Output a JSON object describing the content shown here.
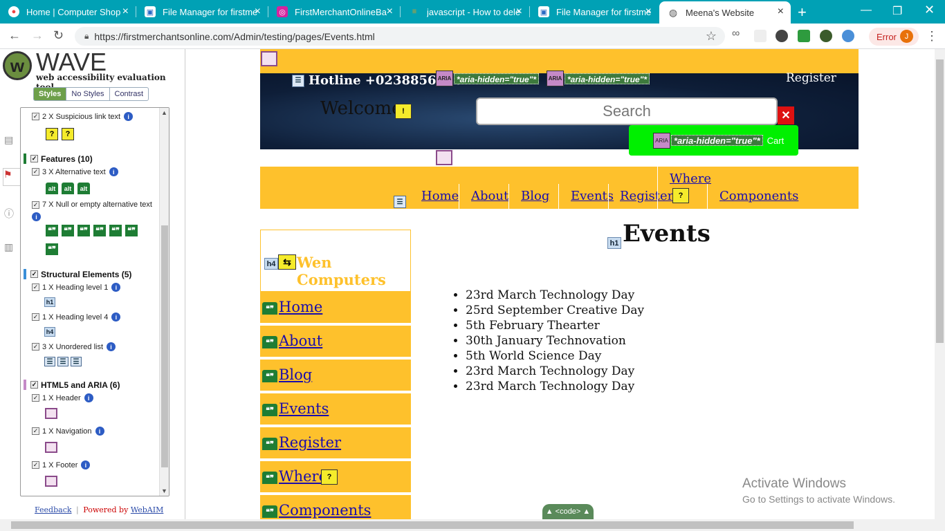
{
  "browser": {
    "tabs": [
      {
        "title": "Home | Computer Shop",
        "icon": "chrome-icon"
      },
      {
        "title": "File Manager for firstme",
        "icon": "file-manager-icon"
      },
      {
        "title": "FirstMerchantOnlineBa",
        "icon": "instagram-icon"
      },
      {
        "title": "javascript - How to dele",
        "icon": "stackoverflow-icon"
      },
      {
        "title": "File Manager for firstme",
        "icon": "file-manager-icon"
      },
      {
        "title": "Meena's Website",
        "icon": "globe-icon"
      }
    ],
    "new_tab": "+",
    "url": "https://firstmerchantsonline.com/Admin/testing/pages/Events.html",
    "error_label": "Error",
    "avatar_initial": "J"
  },
  "wave": {
    "title": "WAVE",
    "subtitle": "web accessibility evaluation tool",
    "view_tabs": [
      "Styles",
      "No Styles",
      "Contrast"
    ],
    "sections": {
      "suspicious": "2 X Suspicious link text",
      "features_header": "Features (10)",
      "alt_text": "3 X Alternative text",
      "null_alt": "7 X Null or empty alternative text",
      "structural_header": "Structural Elements (5)",
      "h1": "1 X Heading level 1",
      "h4": "1 X Heading level 4",
      "ul": "3 X Unordered list",
      "aria_header": "HTML5 and ARIA (6)",
      "header": "1 X Header",
      "navigation": "1 X Navigation",
      "footer": "1 X Footer"
    },
    "footer_feedback": "Feedback",
    "footer_sep": "|",
    "footer_powered": "Powered by",
    "footer_webaim": "WebAIM"
  },
  "site": {
    "hotline": "Hotline +0238856396",
    "aria_hidden_text": "*aria-hidden=\"true\"*",
    "aria_tag": "ARIA",
    "register_top": "Register",
    "welcome": "Welcome",
    "search_placeholder": "Search",
    "cart": "Cart",
    "nav": [
      "Home",
      "About",
      "Blog",
      "Events",
      "Register",
      "Where",
      "Components"
    ],
    "brand": "Wen Computers",
    "side_nav": [
      "Home",
      "About",
      "Blog",
      "Events",
      "Register",
      "Where",
      "Components"
    ],
    "page_heading": "Events",
    "events": [
      "23rd March Technology Day",
      "25rd September Creative Day",
      "5th February Thearter",
      "30th January Technovation",
      "5th World Science Day",
      "23rd March Technology Day",
      "23rd March Technology Day"
    ]
  },
  "overlay": {
    "watermark_line1": "Activate Windows",
    "watermark_line2": "Go to Settings to activate Windows.",
    "code_button": "▲ <code> ▲",
    "alt_icon_label": "alt",
    "quote_icon_label": "❝❞",
    "h1_icon": "h1",
    "h4_icon": "h4"
  },
  "colors": {
    "tabstrip": "#00a1b5",
    "site_yellow": "#fec12c",
    "cart_green": "#00f000",
    "link_blue": "#1a0dab"
  }
}
